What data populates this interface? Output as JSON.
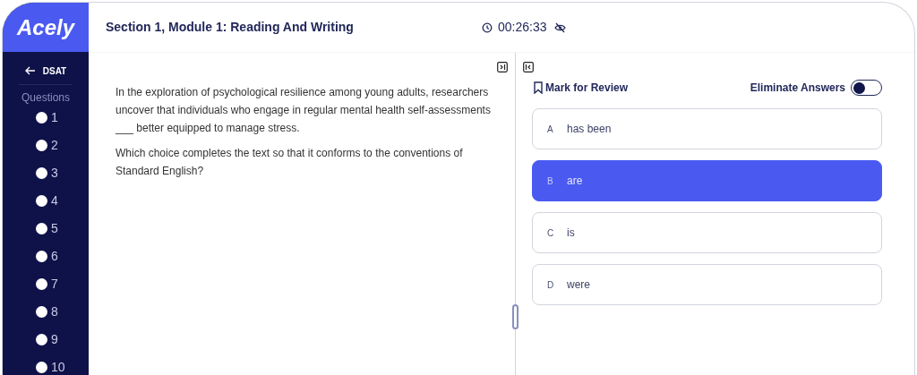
{
  "brand": {
    "logo": "Acely"
  },
  "header": {
    "title": "Section 1, Module 1: Reading And Writing",
    "timer": "00:26:33"
  },
  "sidebar": {
    "back_label": "DSAT",
    "questions_label": "Questions",
    "questions": [
      {
        "label": "1",
        "answered": false
      },
      {
        "label": "2",
        "answered": false
      },
      {
        "label": "3",
        "answered": false
      },
      {
        "label": "4",
        "answered": false
      },
      {
        "label": "5",
        "answered": false
      },
      {
        "label": "6",
        "answered": false
      },
      {
        "label": "7",
        "answered": false
      },
      {
        "label": "8",
        "answered": false
      },
      {
        "label": "9",
        "answered": false
      },
      {
        "label": "10",
        "answered": false
      }
    ]
  },
  "passage": {
    "text": "In the exploration of psychological resilience among young adults, researchers uncover that individuals who engage in regular mental health self-assessments ___ better equipped to manage stress.",
    "prompt": "Which choice completes the text so that it conforms to the conventions of Standard English?"
  },
  "toolbar": {
    "mark_for_review": "Mark for Review",
    "eliminate_answers": {
      "label": "Eliminate Answers",
      "on": false
    }
  },
  "choices": [
    {
      "letter": "A",
      "text": "has been",
      "selected": false
    },
    {
      "letter": "B",
      "text": "are",
      "selected": true
    },
    {
      "letter": "C",
      "text": "is",
      "selected": false
    },
    {
      "letter": "D",
      "text": "were",
      "selected": false
    }
  ]
}
